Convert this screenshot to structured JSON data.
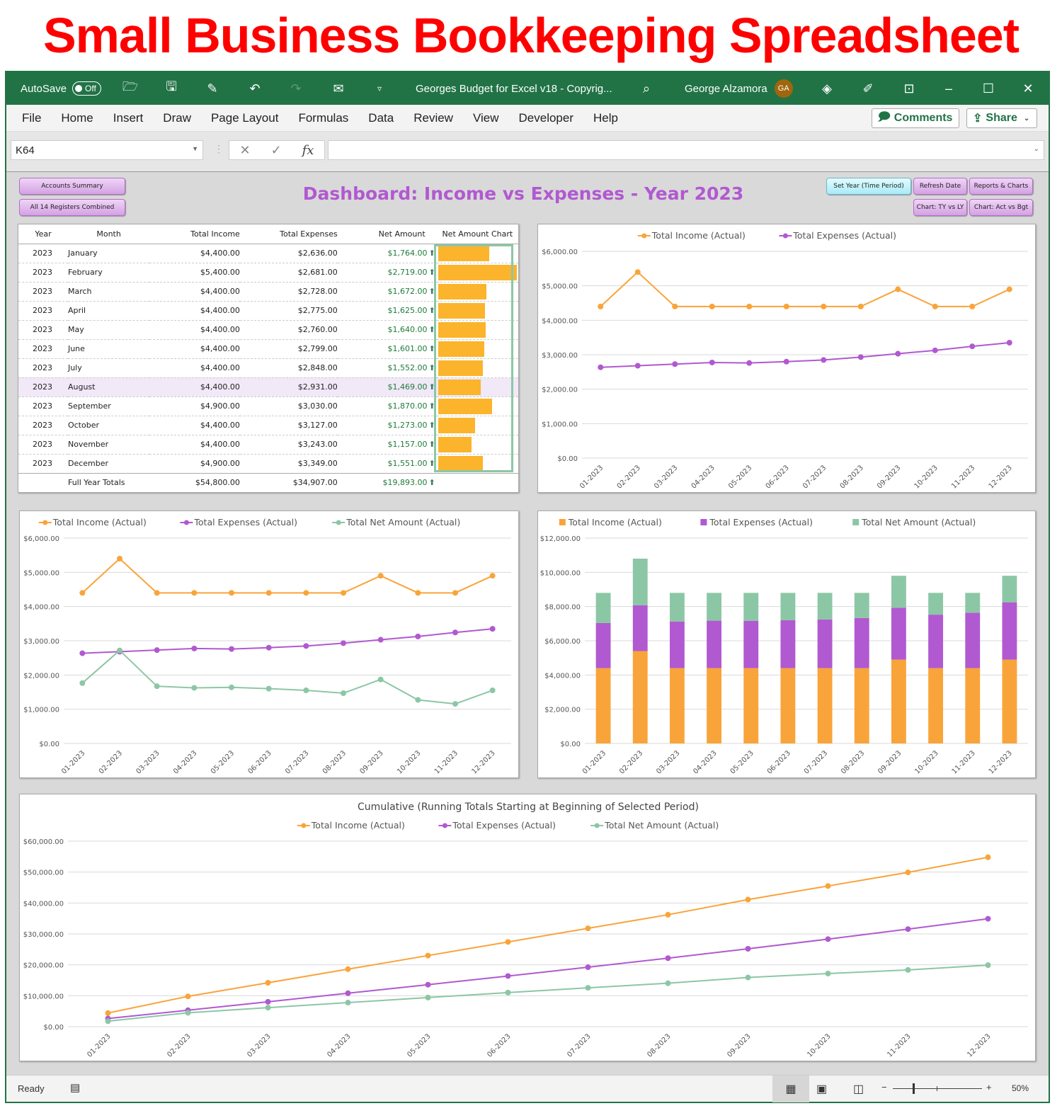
{
  "banner": "Small Business Bookkeeping Spreadsheet",
  "titlebar": {
    "autosave_label": "AutoSave",
    "autosave_state": "Off",
    "doc_title": "Georges Budget for Excel v18 - Copyrig...",
    "user_name": "George Alzamora",
    "user_initials": "GA"
  },
  "menu": [
    "File",
    "Home",
    "Insert",
    "Draw",
    "Page Layout",
    "Formulas",
    "Data",
    "Review",
    "View",
    "Developer",
    "Help"
  ],
  "ribbon_buttons": {
    "comments": "Comments",
    "share": "Share"
  },
  "formula_bar": {
    "name_box": "K64",
    "formula": ""
  },
  "sheet": {
    "buttons": {
      "accounts_summary": "Accounts Summary",
      "all_registers": "All 14 Registers Combined",
      "set_year": "Set Year (Time Period)",
      "refresh_date": "Refresh Date",
      "reports_charts": "Reports & Charts",
      "chart_ty_ly": "Chart: TY vs LY",
      "chart_act_bgt": "Chart: Act vs Bgt"
    },
    "dashboard_title": "Dashboard: Income vs Expenses - Year 2023",
    "table": {
      "headers": [
        "Year",
        "Month",
        "Total Income",
        "Total Expenses",
        "Net Amount",
        "Net Amount Chart"
      ],
      "rows": [
        {
          "year": "2023",
          "month": "January",
          "income": "$4,400.00",
          "expenses": "$2,636.00",
          "net": "$1,764.00",
          "net_value": 1764
        },
        {
          "year": "2023",
          "month": "February",
          "income": "$5,400.00",
          "expenses": "$2,681.00",
          "net": "$2,719.00",
          "net_value": 2719
        },
        {
          "year": "2023",
          "month": "March",
          "income": "$4,400.00",
          "expenses": "$2,728.00",
          "net": "$1,672.00",
          "net_value": 1672
        },
        {
          "year": "2023",
          "month": "April",
          "income": "$4,400.00",
          "expenses": "$2,775.00",
          "net": "$1,625.00",
          "net_value": 1625
        },
        {
          "year": "2023",
          "month": "May",
          "income": "$4,400.00",
          "expenses": "$2,760.00",
          "net": "$1,640.00",
          "net_value": 1640
        },
        {
          "year": "2023",
          "month": "June",
          "income": "$4,400.00",
          "expenses": "$2,799.00",
          "net": "$1,601.00",
          "net_value": 1601
        },
        {
          "year": "2023",
          "month": "July",
          "income": "$4,400.00",
          "expenses": "$2,848.00",
          "net": "$1,552.00",
          "net_value": 1552
        },
        {
          "year": "2023",
          "month": "August",
          "income": "$4,400.00",
          "expenses": "$2,931.00",
          "net": "$1,469.00",
          "net_value": 1469
        },
        {
          "year": "2023",
          "month": "September",
          "income": "$4,900.00",
          "expenses": "$3,030.00",
          "net": "$1,870.00",
          "net_value": 1870
        },
        {
          "year": "2023",
          "month": "October",
          "income": "$4,400.00",
          "expenses": "$3,127.00",
          "net": "$1,273.00",
          "net_value": 1273
        },
        {
          "year": "2023",
          "month": "November",
          "income": "$4,400.00",
          "expenses": "$3,243.00",
          "net": "$1,157.00",
          "net_value": 1157
        },
        {
          "year": "2023",
          "month": "December",
          "income": "$4,900.00",
          "expenses": "$3,349.00",
          "net": "$1,551.00",
          "net_value": 1551
        }
      ],
      "highlighted_row": 7,
      "totals": {
        "label": "Full Year Totals",
        "income": "$54,800.00",
        "expenses": "$34,907.00",
        "net": "$19,893.00"
      }
    }
  },
  "colors": {
    "income": "#f9a43a",
    "expenses": "#b159d0",
    "net": "#8cc7a5",
    "title_purple": "#b159d0",
    "excel_green": "#217346"
  },
  "chart_data": [
    {
      "id": "income-vs-expenses-line",
      "type": "line",
      "title": "",
      "categories": [
        "01-2023",
        "02-2023",
        "03-2023",
        "04-2023",
        "05-2023",
        "06-2023",
        "07-2023",
        "08-2023",
        "09-2023",
        "10-2023",
        "11-2023",
        "12-2023"
      ],
      "series": [
        {
          "name": "Total Income (Actual)",
          "values": [
            4400,
            5400,
            4400,
            4400,
            4400,
            4400,
            4400,
            4400,
            4900,
            4400,
            4400,
            4900
          ]
        },
        {
          "name": "Total Expenses (Actual)",
          "values": [
            2636,
            2681,
            2728,
            2775,
            2760,
            2799,
            2848,
            2931,
            3030,
            3127,
            3243,
            3349
          ]
        }
      ],
      "ylim": [
        0,
        6000
      ],
      "yticks": [
        "$0.00",
        "$1,000.00",
        "$2,000.00",
        "$3,000.00",
        "$4,000.00",
        "$5,000.00",
        "$6,000.00"
      ],
      "legend": "top",
      "grid": true
    },
    {
      "id": "income-expenses-net-line",
      "type": "line",
      "title": "",
      "categories": [
        "01-2023",
        "02-2023",
        "03-2023",
        "04-2023",
        "05-2023",
        "06-2023",
        "07-2023",
        "08-2023",
        "09-2023",
        "10-2023",
        "11-2023",
        "12-2023"
      ],
      "series": [
        {
          "name": "Total Income (Actual)",
          "values": [
            4400,
            5400,
            4400,
            4400,
            4400,
            4400,
            4400,
            4400,
            4900,
            4400,
            4400,
            4900
          ]
        },
        {
          "name": "Total Expenses (Actual)",
          "values": [
            2636,
            2681,
            2728,
            2775,
            2760,
            2799,
            2848,
            2931,
            3030,
            3127,
            3243,
            3349
          ]
        },
        {
          "name": "Total Net Amount (Actual)",
          "values": [
            1764,
            2719,
            1672,
            1625,
            1640,
            1601,
            1552,
            1469,
            1870,
            1273,
            1157,
            1551
          ]
        }
      ],
      "ylim": [
        0,
        6000
      ],
      "yticks": [
        "$0.00",
        "$1,000.00",
        "$2,000.00",
        "$3,000.00",
        "$4,000.00",
        "$5,000.00",
        "$6,000.00"
      ],
      "legend": "top",
      "grid": true
    },
    {
      "id": "stacked-bar",
      "type": "bar",
      "stacked": true,
      "title": "",
      "categories": [
        "01-2023",
        "02-2023",
        "03-2023",
        "04-2023",
        "05-2023",
        "06-2023",
        "07-2023",
        "08-2023",
        "09-2023",
        "10-2023",
        "11-2023",
        "12-2023"
      ],
      "series": [
        {
          "name": "Total Income (Actual)",
          "values": [
            4400,
            5400,
            4400,
            4400,
            4400,
            4400,
            4400,
            4400,
            4900,
            4400,
            4400,
            4900
          ]
        },
        {
          "name": "Total Expenses (Actual)",
          "values": [
            2636,
            2681,
            2728,
            2775,
            2760,
            2799,
            2848,
            2931,
            3030,
            3127,
            3243,
            3349
          ]
        },
        {
          "name": "Total Net Amount (Actual)",
          "values": [
            1764,
            2719,
            1672,
            1625,
            1640,
            1601,
            1552,
            1469,
            1870,
            1273,
            1157,
            1551
          ]
        }
      ],
      "ylim": [
        0,
        12000
      ],
      "yticks": [
        "$0.00",
        "$2,000.00",
        "$4,000.00",
        "$6,000.00",
        "$8,000.00",
        "$10,000.00",
        "$12,000.00"
      ],
      "legend": "top",
      "grid": true
    },
    {
      "id": "cumulative-line",
      "type": "line",
      "title": "Cumulative (Running Totals Starting at Beginning of Selected Period)",
      "categories": [
        "01-2023",
        "02-2023",
        "03-2023",
        "04-2023",
        "05-2023",
        "06-2023",
        "07-2023",
        "08-2023",
        "09-2023",
        "10-2023",
        "11-2023",
        "12-2023"
      ],
      "series": [
        {
          "name": "Total Income (Actual)",
          "values": [
            4400,
            9800,
            14200,
            18600,
            23000,
            27400,
            31800,
            36200,
            41100,
            45500,
            49900,
            54800
          ]
        },
        {
          "name": "Total Expenses (Actual)",
          "values": [
            2636,
            5317,
            8045,
            10820,
            13580,
            16379,
            19227,
            22158,
            25188,
            28315,
            31558,
            34907
          ]
        },
        {
          "name": "Total Net Amount (Actual)",
          "values": [
            1764,
            4483,
            6155,
            7780,
            9420,
            11021,
            12573,
            14042,
            15912,
            17185,
            18342,
            19893
          ]
        }
      ],
      "ylim": [
        0,
        60000
      ],
      "yticks": [
        "$0.00",
        "$10,000.00",
        "$20,000.00",
        "$30,000.00",
        "$40,000.00",
        "$50,000.00",
        "$60,000.00"
      ],
      "legend": "top",
      "grid": true
    }
  ],
  "status_bar": {
    "status": "Ready",
    "zoom": "50%"
  }
}
